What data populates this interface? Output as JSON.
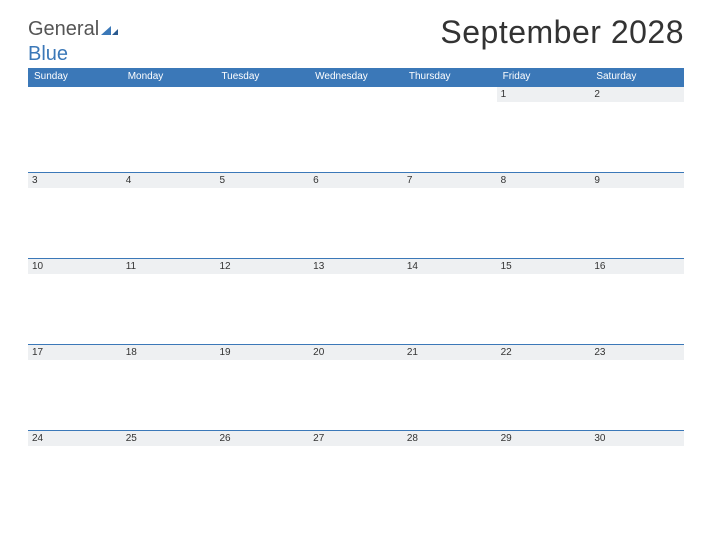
{
  "brand": {
    "part1": "General",
    "part2": "Blue"
  },
  "title": "September 2028",
  "days": [
    "Sunday",
    "Monday",
    "Tuesday",
    "Wednesday",
    "Thursday",
    "Friday",
    "Saturday"
  ],
  "weeks": [
    [
      null,
      null,
      null,
      null,
      null,
      "1",
      "2"
    ],
    [
      "3",
      "4",
      "5",
      "6",
      "7",
      "8",
      "9"
    ],
    [
      "10",
      "11",
      "12",
      "13",
      "14",
      "15",
      "16"
    ],
    [
      "17",
      "18",
      "19",
      "20",
      "21",
      "22",
      "23"
    ],
    [
      "24",
      "25",
      "26",
      "27",
      "28",
      "29",
      "30"
    ]
  ]
}
